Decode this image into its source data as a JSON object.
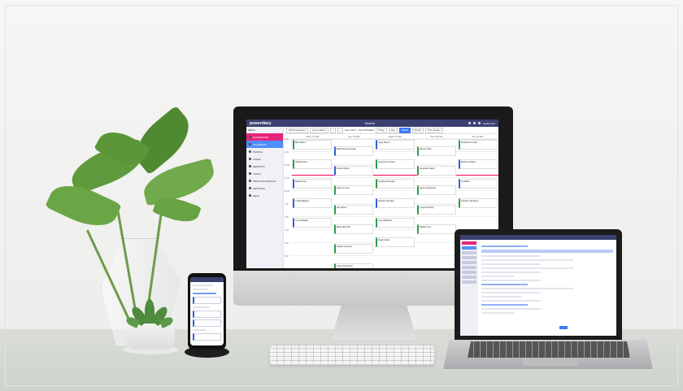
{
  "app": {
    "logo": "powerdiary",
    "search_label": "Search",
    "user_label": "Health Hub"
  },
  "sidebar": {
    "header": "MENU",
    "items": [
      {
        "label": "DASHBOARD",
        "icon": "dashboard-icon"
      },
      {
        "label": "CALENDAR",
        "icon": "calendar-icon"
      },
      {
        "label": "PEOPLE",
        "icon": "people-icon"
      },
      {
        "label": "SALES",
        "icon": "sales-icon"
      },
      {
        "label": "REPORTS",
        "icon": "reports-icon"
      },
      {
        "label": "TOOLS",
        "icon": "tools-icon"
      },
      {
        "label": "PRACTICE MANUAL",
        "icon": "manual-icon"
      },
      {
        "label": "SETTINGS",
        "icon": "settings-icon"
      },
      {
        "label": "HELP",
        "icon": "help-icon"
      }
    ]
  },
  "toolbar": {
    "practitioners": "All Practitioners",
    "locations": "All Locations",
    "date_range": "Sun 7/2/17 - Sat 7/27/2024",
    "day_label": "5 Day",
    "views": [
      "Day",
      "Week",
      "Month"
    ],
    "active_view": "Week",
    "print_label": "Print Roster"
  },
  "calendar": {
    "days": [
      "Mon 7/1 Mo",
      "Tue 7/2 Mo",
      "Wed 7/3 Mo",
      "Thu 7/4 Mo",
      "Fri 7/5 Mo"
    ],
    "times": [
      "8:00",
      "9:00",
      "10:00",
      "11:00",
      "12:00",
      "1:00",
      "2:00",
      "3:00",
      "4:00",
      "5:00"
    ],
    "appointments": [
      {
        "name": "Jorge Rivera",
        "day": 2
      },
      {
        "name": "Wendy Yates",
        "day": 3
      },
      {
        "name": "Beth Wilson",
        "day": 0
      },
      {
        "name": "Bartholomew George",
        "day": 1
      },
      {
        "name": "Stephanie Preston",
        "day": 4
      },
      {
        "name": "Sophia Grant",
        "day": 0
      },
      {
        "name": "Dorian Palmer",
        "day": 1
      },
      {
        "name": "Genevieve Greene",
        "day": 2
      },
      {
        "name": "Alexander Carter",
        "day": 3
      },
      {
        "name": "Brandon Rogers",
        "day": 4
      },
      {
        "name": "Florence Irwin",
        "day": 1
      },
      {
        "name": "Agnes Sanderson",
        "day": 3
      },
      {
        "name": "Maxwell Fay",
        "day": 0
      },
      {
        "name": "Lilly Rivera",
        "day": 1
      },
      {
        "name": "Timothy Harrington",
        "day": 2
      },
      {
        "name": "Iris Watts",
        "day": 4
      },
      {
        "name": "Louise Kimberly",
        "day": 3
      },
      {
        "name": "Becky Bancroft",
        "day": 1
      },
      {
        "name": "Anthony Sheridan",
        "day": 2
      },
      {
        "name": "Nathan Kent",
        "day": 3
      },
      {
        "name": "Caroline Johnstone",
        "day": 4
      },
      {
        "name": "Cyrilia Madison",
        "day": 0
      },
      {
        "name": "Sophie Germany",
        "day": 1
      },
      {
        "name": "Anne Matthews",
        "day": 2
      },
      {
        "name": "Cyrus Baldwin",
        "day": 0
      },
      {
        "name": "Carey Hutchinson",
        "day": 1
      },
      {
        "name": "Regan Asher",
        "day": 2
      }
    ]
  },
  "colors": {
    "topbar": "#3a4070",
    "dashboard": "#e6267a",
    "calendar": "#4f8ef7",
    "appointment_green": "#2e9a4a",
    "appointment_blue": "#2f5fd6"
  }
}
